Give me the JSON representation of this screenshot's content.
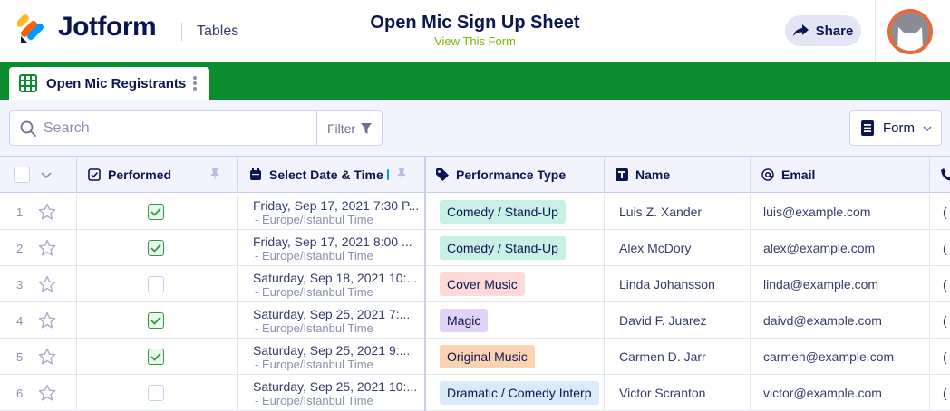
{
  "header": {
    "brand": "Jotform",
    "product": "Tables",
    "form_title": "Open Mic Sign Up Sheet",
    "form_link": "View This Form",
    "share_label": "Share"
  },
  "tabs": [
    {
      "label": "Open Mic Registrants"
    }
  ],
  "toolbar": {
    "search_placeholder": "Search",
    "filter_label": "Filter",
    "form_label": "Form"
  },
  "columns": {
    "performed": "Performed",
    "date": "Select Date & Time",
    "type": "Performance Type",
    "name": "Name",
    "email": "Email"
  },
  "rows": [
    {
      "num": "1",
      "performed": true,
      "date": "Friday, Sep 17, 2021 7:30 P...",
      "tz": "- Europe/Istanbul Time",
      "type": "Comedy / Stand-Up",
      "type_color": "#c8f0e6",
      "name": "Luis Z. Xander",
      "email": "luis@example.com",
      "extra": "("
    },
    {
      "num": "2",
      "performed": true,
      "date": "Friday, Sep 17, 2021 8:00 ...",
      "tz": "- Europe/Istanbul Time",
      "type": "Comedy / Stand-Up",
      "type_color": "#c8f0e6",
      "name": "Alex McDory",
      "email": "alex@example.com",
      "extra": "("
    },
    {
      "num": "3",
      "performed": false,
      "date": "Saturday, Sep 18, 2021 10:...",
      "tz": "- Europe/Istanbul Time",
      "type": "Cover Music",
      "type_color": "#fdd9d9",
      "name": "Linda Johansson",
      "email": "linda@example.com",
      "extra": "("
    },
    {
      "num": "4",
      "performed": true,
      "date": "Saturday, Sep 25, 2021 7:...",
      "tz": "- Europe/Istanbul Time",
      "type": "Magic",
      "type_color": "#e1d2f7",
      "name": "David F. Juarez",
      "email": "daivd@example.com",
      "extra": "("
    },
    {
      "num": "5",
      "performed": true,
      "date": "Saturday, Sep 25, 2021 9:...",
      "tz": "- Europe/Istanbul Time",
      "type": "Original Music",
      "type_color": "#fcd3b0",
      "name": "Carmen D. Jarr",
      "email": "carmen@example.com",
      "extra": "("
    },
    {
      "num": "6",
      "performed": false,
      "date": "Saturday, Sep 25, 2021 10:...",
      "tz": "- Europe/Istanbul Time",
      "type": "Dramatic / Comedy Interp",
      "type_color": "#d9ebfb",
      "name": "Victor Scranton",
      "email": "victor@example.com",
      "extra": "("
    }
  ],
  "colors": {
    "tabbar": "#0a8c2f",
    "accent_link": "#78bb07",
    "navy": "#0a1551",
    "avatar_ring": "#e86a3a"
  }
}
